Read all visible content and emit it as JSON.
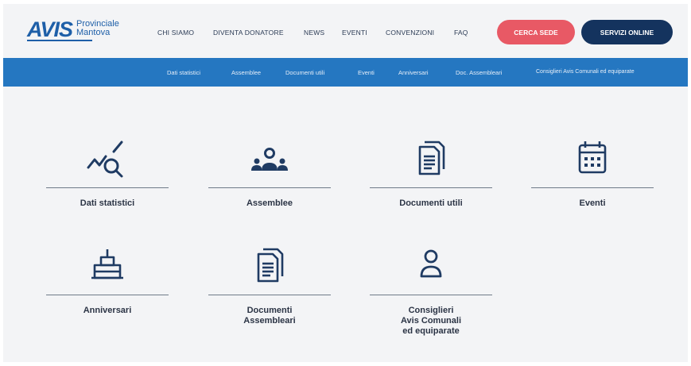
{
  "header": {
    "logo": {
      "mark": "AVIS",
      "line1": "Provinciale",
      "line2": "Mantova"
    },
    "nav": [
      "CHI SIAMO",
      "DIVENTA DONATORE",
      "NEWS",
      "EVENTI",
      "CONVENZIONI",
      "FAQ"
    ],
    "cta_primary": "CERCA SEDE",
    "cta_secondary": "SERVIZI ONLINE"
  },
  "subnav": [
    "Dati statistici",
    "Assemblee",
    "Documenti utili",
    "Eventi",
    "Anniversari",
    "Doc. Assembleari",
    "Consiglieri Avis Comunali ed equiparate"
  ],
  "tiles": [
    {
      "label": "Dati statistici",
      "icon": "chart-search-icon"
    },
    {
      "label": "Assemblee",
      "icon": "group-icon"
    },
    {
      "label": "Documenti utili",
      "icon": "documents-icon"
    },
    {
      "label": "Eventi",
      "icon": "calendar-icon"
    },
    {
      "label": "Anniversari",
      "icon": "cake-icon"
    },
    {
      "label": "Documenti\nAssembleari",
      "icon": "documents-icon"
    },
    {
      "label": "Consiglieri\nAvis Comunali\ned equiparate",
      "icon": "user-icon"
    }
  ],
  "colors": {
    "brand": "#1e5fa8",
    "subnav": "#2577c1",
    "cta_red": "#e85965",
    "cta_dark": "#14335e",
    "icon": "#1f3b63"
  }
}
